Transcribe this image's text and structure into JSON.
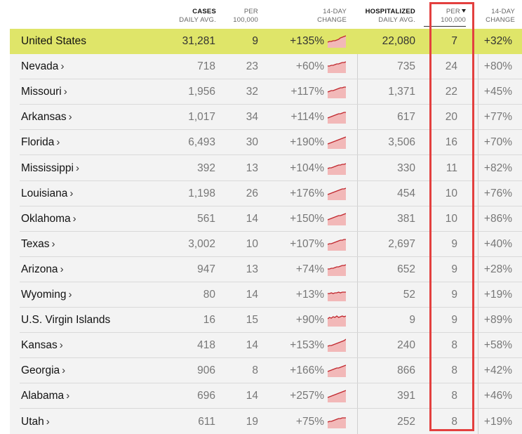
{
  "headers": {
    "cases_line1": "CASES",
    "cases_line2": "DAILY AVG.",
    "per_cases_line1": "PER",
    "per_cases_line2": "100,000",
    "change_cases_line1": "14-DAY",
    "change_cases_line2": "CHANGE",
    "hosp_line1": "HOSPITALIZED",
    "hosp_line2": "DAILY AVG.",
    "per_hosp_line1": "PER",
    "per_hosp_line2": "100,000",
    "change_hosp_line1": "14-DAY",
    "change_hosp_line2": "CHANGE"
  },
  "colors": {
    "us_highlight": "#dfe569",
    "spark_line": "#c0272d",
    "spark_fill": "#f2b8b8",
    "annotation_box": "#e3403f"
  },
  "sort_indicator": "caret-down-icon",
  "rows": [
    {
      "name": "United States",
      "link": false,
      "cases": "31,281",
      "cases_per": "9",
      "cases_change": "+135%",
      "hosp": "22,080",
      "hosp_per": "7",
      "hosp_change": "+32%"
    },
    {
      "name": "Nevada",
      "link": true,
      "cases": "718",
      "cases_per": "23",
      "cases_change": "+60%",
      "hosp": "735",
      "hosp_per": "24",
      "hosp_change": "+80%"
    },
    {
      "name": "Missouri",
      "link": true,
      "cases": "1,956",
      "cases_per": "32",
      "cases_change": "+117%",
      "hosp": "1,371",
      "hosp_per": "22",
      "hosp_change": "+45%"
    },
    {
      "name": "Arkansas",
      "link": true,
      "cases": "1,017",
      "cases_per": "34",
      "cases_change": "+114%",
      "hosp": "617",
      "hosp_per": "20",
      "hosp_change": "+77%"
    },
    {
      "name": "Florida",
      "link": true,
      "cases": "6,493",
      "cases_per": "30",
      "cases_change": "+190%",
      "hosp": "3,506",
      "hosp_per": "16",
      "hosp_change": "+70%"
    },
    {
      "name": "Mississippi",
      "link": true,
      "cases": "392",
      "cases_per": "13",
      "cases_change": "+104%",
      "hosp": "330",
      "hosp_per": "11",
      "hosp_change": "+82%"
    },
    {
      "name": "Louisiana",
      "link": true,
      "cases": "1,198",
      "cases_per": "26",
      "cases_change": "+176%",
      "hosp": "454",
      "hosp_per": "10",
      "hosp_change": "+76%"
    },
    {
      "name": "Oklahoma",
      "link": true,
      "cases": "561",
      "cases_per": "14",
      "cases_change": "+150%",
      "hosp": "381",
      "hosp_per": "10",
      "hosp_change": "+86%"
    },
    {
      "name": "Texas",
      "link": true,
      "cases": "3,002",
      "cases_per": "10",
      "cases_change": "+107%",
      "hosp": "2,697",
      "hosp_per": "9",
      "hosp_change": "+40%"
    },
    {
      "name": "Arizona",
      "link": true,
      "cases": "947",
      "cases_per": "13",
      "cases_change": "+74%",
      "hosp": "652",
      "hosp_per": "9",
      "hosp_change": "+28%"
    },
    {
      "name": "Wyoming",
      "link": true,
      "cases": "80",
      "cases_per": "14",
      "cases_change": "+13%",
      "hosp": "52",
      "hosp_per": "9",
      "hosp_change": "+19%"
    },
    {
      "name": "U.S. Virgin Islands",
      "link": false,
      "cases": "16",
      "cases_per": "15",
      "cases_change": "+90%",
      "hosp": "9",
      "hosp_per": "9",
      "hosp_change": "+89%"
    },
    {
      "name": "Kansas",
      "link": true,
      "cases": "418",
      "cases_per": "14",
      "cases_change": "+153%",
      "hosp": "240",
      "hosp_per": "8",
      "hosp_change": "+58%"
    },
    {
      "name": "Georgia",
      "link": true,
      "cases": "906",
      "cases_per": "8",
      "cases_change": "+166%",
      "hosp": "866",
      "hosp_per": "8",
      "hosp_change": "+42%"
    },
    {
      "name": "Alabama",
      "link": true,
      "cases": "696",
      "cases_per": "14",
      "cases_change": "+257%",
      "hosp": "391",
      "hosp_per": "8",
      "hosp_change": "+46%"
    },
    {
      "name": "Utah",
      "link": true,
      "cases": "611",
      "cases_per": "19",
      "cases_change": "+75%",
      "hosp": "252",
      "hosp_per": "8",
      "hosp_change": "+19%"
    }
  ]
}
